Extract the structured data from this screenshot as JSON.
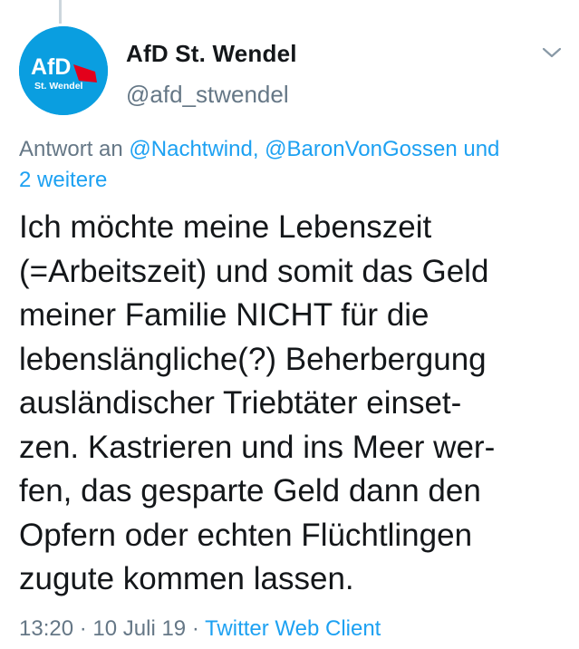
{
  "tweet": {
    "avatar": {
      "logo_text": "AfD",
      "logo_subtext": "St. Wendel",
      "bg_color": "#0a9ee0",
      "accent_color": "#e3001b"
    },
    "display_name": "AfD St. Wendel",
    "handle": "@afd_stwendel",
    "reply_to": {
      "prefix": "Antwort an",
      "mention_1": "@Nachtwind,",
      "mention_2": "@BaronVonGossen",
      "mention_3": "und",
      "mention_4": "2 weitere"
    },
    "text_lines": [
      "Ich möchte meine Lebenszeit",
      "(=Arbeitszeit) und somit das Geld",
      "meiner Familie NICHT für die",
      "lebenslängliche(?) Beherbergung",
      "ausländischer Triebtäter einset-",
      "zen. Kastrieren und ins Meer wer-",
      "fen, das gesparte Geld dann den",
      "Opfern oder echten Flüchtlingen",
      "zugute kommen lassen."
    ],
    "time": "13:20",
    "date": "10 Juli 19",
    "separator": "·",
    "client": "Twitter Web Client"
  }
}
